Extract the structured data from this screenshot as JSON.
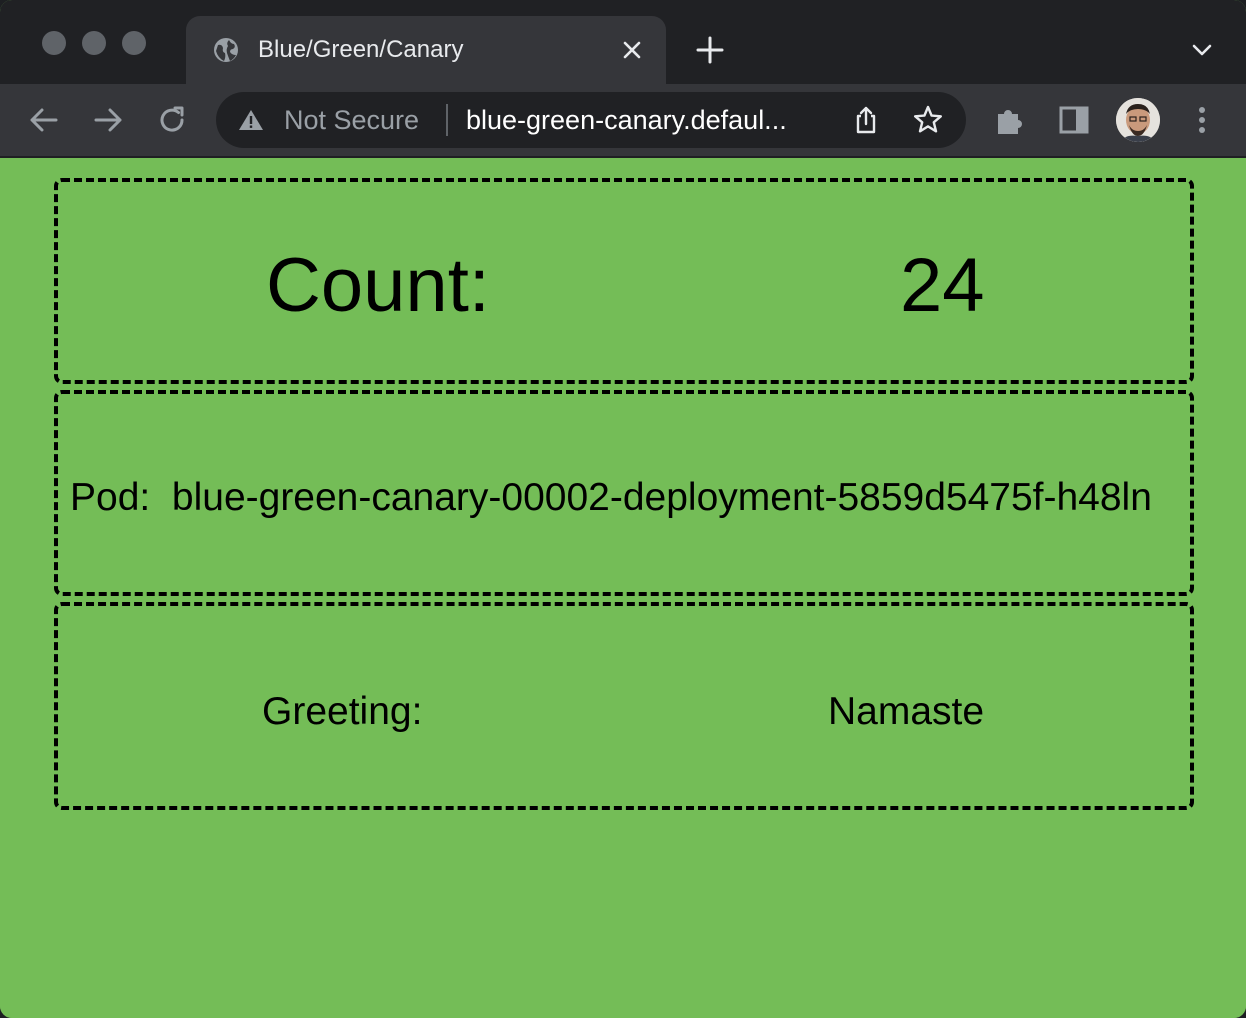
{
  "browser": {
    "tab_title": "Blue/Green/Canary",
    "security_label": "Not Secure",
    "url": "blue-green-canary.defaul..."
  },
  "icons": {
    "tab_favicon": "globe-icon",
    "tab_close": "close-icon",
    "new_tab": "plus-icon",
    "tab_search": "chevron-down-icon",
    "back": "arrow-left-icon",
    "forward": "arrow-right-icon",
    "reload": "reload-icon",
    "security": "warning-icon",
    "share": "share-icon",
    "bookmark": "star-icon",
    "extensions": "puzzle-icon",
    "side_panel": "side-panel-icon",
    "menu": "kebab-icon"
  },
  "page": {
    "count_label": "Count:",
    "count_value": "24",
    "pod_label": "Pod:",
    "pod_value": "blue-green-canary-00002-deployment-5859d5475f-h48ln",
    "greeting_label": "Greeting:",
    "greeting_value": "Namaste"
  },
  "colors": {
    "page_background": "#74bd57",
    "border": "#000000",
    "browser_frame": "#202124",
    "toolbar": "#35363a"
  }
}
